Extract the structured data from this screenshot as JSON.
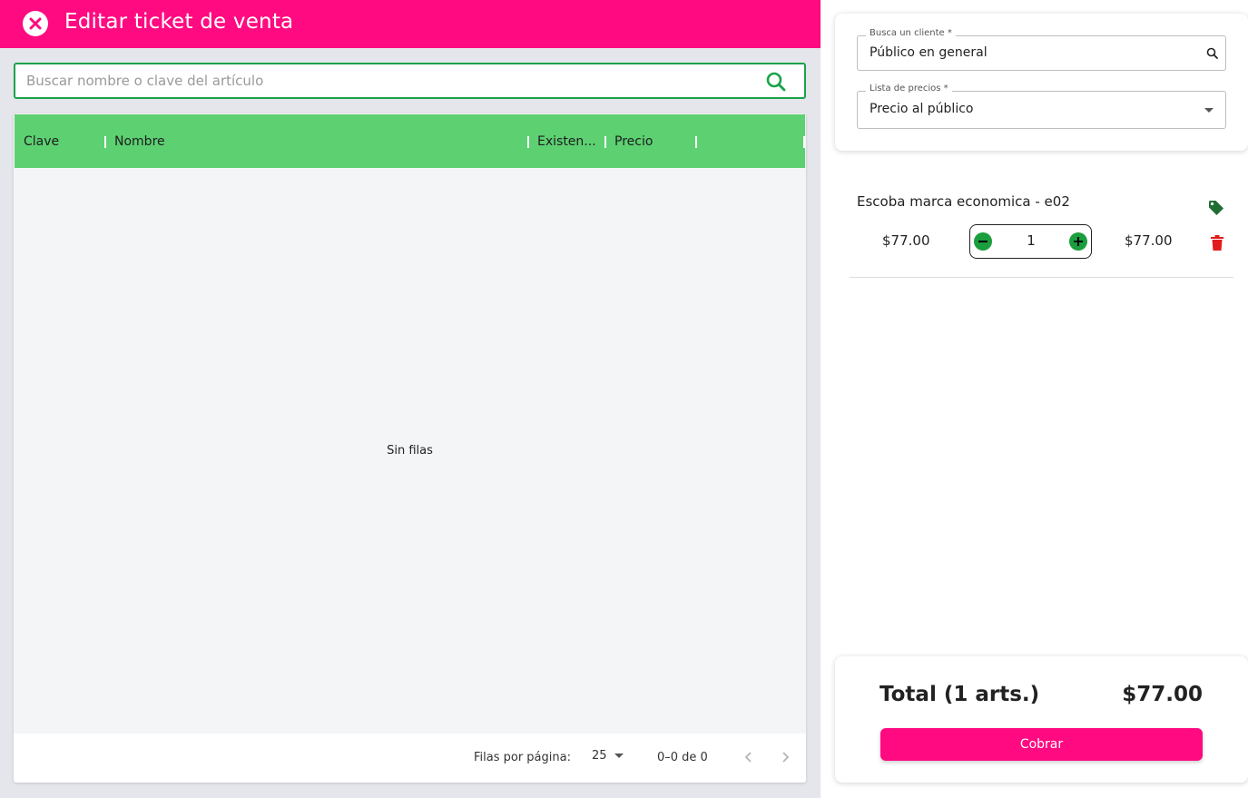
{
  "header": {
    "title": "Editar ticket de venta",
    "close_icon": "close-icon"
  },
  "search": {
    "placeholder": "Buscar nombre o clave del artículo",
    "value": ""
  },
  "grid": {
    "columns": [
      "Clave",
      "Nombre",
      "Existen...",
      "Precio"
    ],
    "empty_text": "Sin filas",
    "footer": {
      "rows_label": "Filas por página:",
      "rows_value": "25",
      "range": "0–0 de 0"
    }
  },
  "client": {
    "customer_label": "Busca un cliente *",
    "customer_value": "Público en general",
    "price_list_label": "Lista de precios *",
    "price_list_value": "Precio al público"
  },
  "cart": {
    "items": [
      {
        "name": "Escoba marca economica - e02",
        "unit_price": "$77.00",
        "quantity": "1",
        "line_total": "$77.00"
      }
    ]
  },
  "summary": {
    "total_label": "Total (1 arts.)",
    "total_value": "$77.00",
    "pay_label": "Cobrar"
  },
  "colors": {
    "brand": "#ff0a81",
    "header_green": "#5dd072",
    "search_border": "#1aa34a",
    "qty_green": "#1b9e3e",
    "trash_red": "#e01c1c",
    "tag_green": "#1f6e33"
  }
}
